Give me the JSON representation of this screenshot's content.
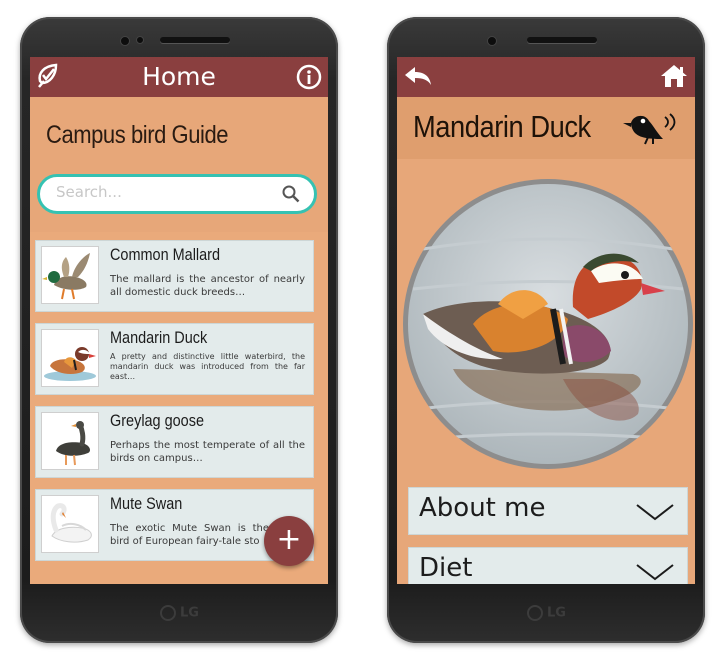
{
  "home_screen": {
    "header_title": "Home",
    "guide_title": "Campus bird Guide",
    "search_placeholder": "Search...",
    "birds": [
      {
        "name": "Common Mallard",
        "description": "The mallard is the ancestor of nearly all domestic duck breeds…"
      },
      {
        "name": "Mandarin Duck",
        "description": "A pretty and distinctive little waterbird, the mandarin duck was introduced from the far east…"
      },
      {
        "name": "Greylag goose",
        "description": "Perhaps the most temperate of all the birds on campus…"
      },
      {
        "name": "Mute Swan",
        "description": "The exotic Mute Swan is the bird of European fairy-tale sto"
      }
    ],
    "fab_symbol": "+",
    "icons": {
      "logo": "check-leaf-icon",
      "info": "info-icon",
      "search": "search-icon"
    }
  },
  "detail_screen": {
    "bird_name": "Mandarin Duck",
    "sections": [
      "About me",
      "Diet"
    ],
    "icons": {
      "back": "back-arrow-icon",
      "home": "home-icon",
      "sound": "bird-call-icon",
      "expand": "chevron-down-icon"
    }
  },
  "device": {
    "brand": "LG"
  },
  "colors": {
    "header": "#8a3f3f",
    "background": "#e7a779",
    "search_border": "#35c2b2",
    "card": "#e3ebeb"
  }
}
